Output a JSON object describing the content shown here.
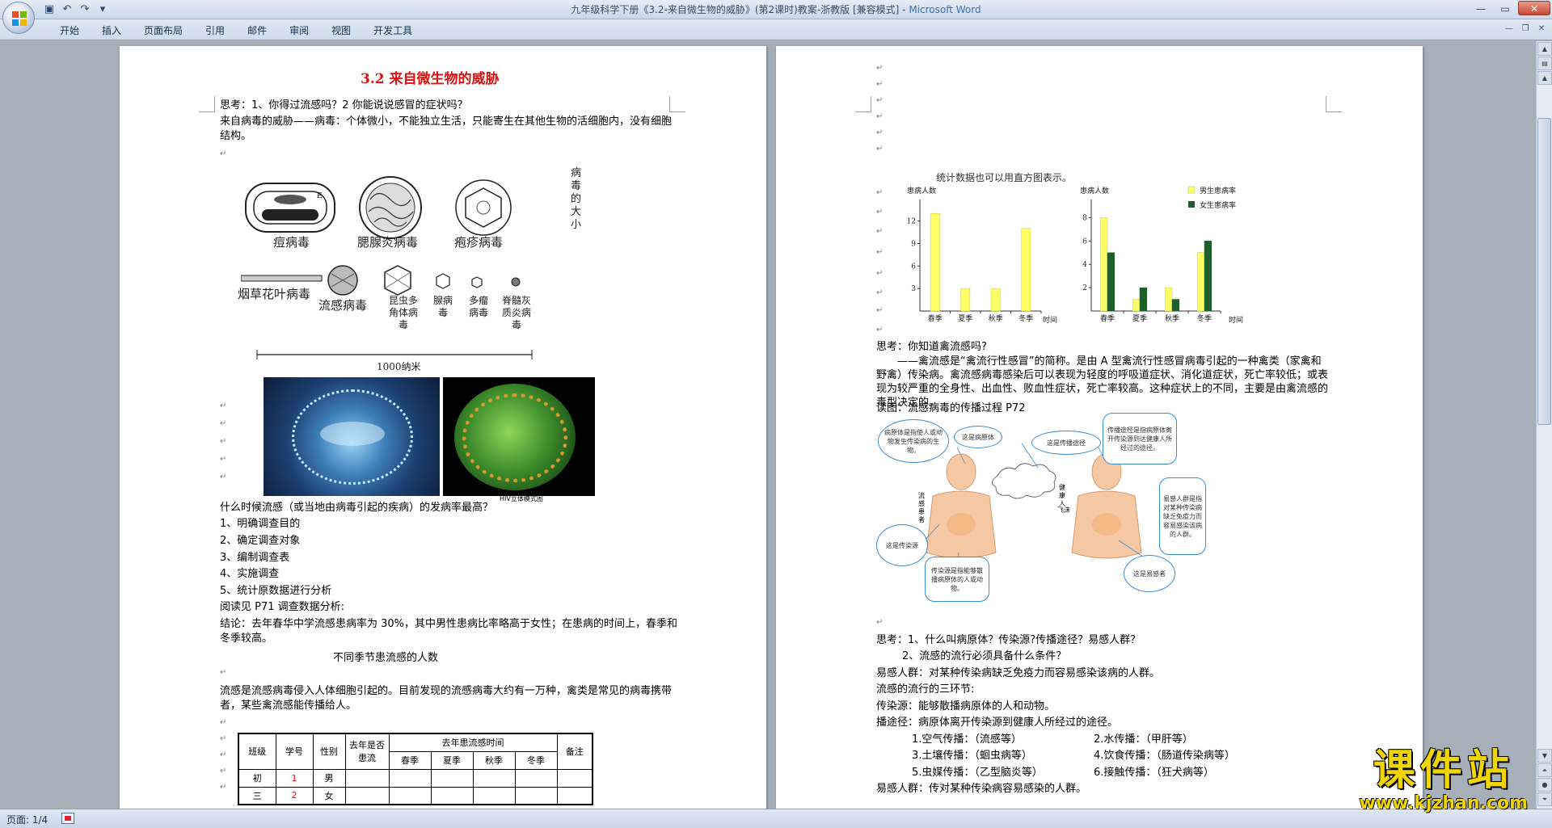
{
  "window": {
    "title_doc": "九年级科学下册《3.2-来自微生物的威胁》(第2课时)教案-浙教版 [兼容模式]",
    "title_sep": " - ",
    "title_app": "Microsoft Word"
  },
  "ribbon": {
    "tabs": [
      "开始",
      "插入",
      "页面布局",
      "引用",
      "邮件",
      "审阅",
      "视图",
      "开发工具"
    ]
  },
  "status": {
    "page": "页面: 1/4"
  },
  "watermark": {
    "brand": "课件站",
    "url": "www.kjzhan.com"
  },
  "page1": {
    "title": "3.2  来自微生物的威胁",
    "think1": "思考：1、你得过流感吗？2 你能说说感冒的症状吗？",
    "virus_intro": "来自病毒的威胁——病毒：个体微小，不能独立生活，只能寄生在其他生物的活细胞内，没有细胞结构。",
    "virus_names_row1": [
      "痘病毒",
      "腮腺炎病毒",
      "疱疹病毒"
    ],
    "virus_size_label": "病毒的大小",
    "virus_names_row2": [
      "烟草花叶病毒",
      "流感病毒",
      "昆虫多角体病毒",
      "腺病毒",
      "多瘤病毒",
      "脊髓灰质炎病毒"
    ],
    "scale_label": "1000纳米",
    "photo_caption": "HIV立体模式图",
    "question": "什么时候流感（或当地由病毒引起的疾病）的发病率最高？",
    "steps": [
      "1、明确调查目的",
      "2、确定调查对象",
      "3、编制调查表",
      "4、实施调查",
      "5、统计原数据进行分析"
    ],
    "read": "阅读见 P71 调查数据分析:",
    "conclusion": "结论：去年春华中学流感患病率为 30%，其中男性患病比率略高于女性；在患病的时间上，春季和冬季较高。",
    "table_title": "不同季节患流感的人数",
    "flu_text": "流感是流感病毒侵入人体细胞引起的。目前发现的流感病毒大约有一万种，禽类是常见的病毒携带者，某些禽流感能传播给人。",
    "table": {
      "headers": [
        "班级",
        "学号",
        "性别",
        "去年是否患流",
        "去年患流感时间",
        "备注"
      ],
      "seasons": [
        "春季",
        "夏季",
        "秋季",
        "冬季"
      ],
      "rows": [
        {
          "class": "初",
          "id": "1",
          "sex": "男"
        },
        {
          "class": "三",
          "id": "2",
          "sex": "女"
        }
      ]
    }
  },
  "page2": {
    "chart_caption": "统计数据也可以用直方图表示。",
    "think2": "思考：你知道禽流感吗?",
    "bird_flu_text": "——禽流感是“禽流行性感冒”的简称。是由 A 型禽流行性感冒病毒引起的一种禽类（家禽和野禽）传染病。禽流感病毒感染后可以表现为轻度的呼吸道症状、消化道症状，死亡率较低；或表现为较严重的全身性、出血性、败血性症状，死亡率较高。这种症状上的不同，主要是由禽流感的毒型决定的。",
    "read_fig": "读图：流感病毒的传播过程 P72",
    "diagram": {
      "pathogen": "病原体是指使人或动物发生传染病的生物。",
      "host_a": "这是病原体",
      "host_b": "这是传播途径",
      "route": "传播途径是指病原体离开传染源到达健康人所经过的途径。",
      "susceptible": "易感人群是指对某种传染病缺乏免疫力而容易感染该病的人群。",
      "source": "传染源是指能够散播病原体的人或动物。",
      "source_b": "这是传染源",
      "sus_b": "这是易感者",
      "label_patient": "流感患者",
      "label_healthy": "健康人",
      "label_fly": "飞沫"
    },
    "think3": "思考：1、什么叫病原体？传染源?传播途径？易感人群？",
    "think3b": "2、流感的流行必须具备什么条件？",
    "def_susceptible": "易感人群：对某种传染病缺乏免疫力而容易感染该病的人群。",
    "three_links": "流感的流行的三环节:",
    "def_source": "传染源：能够散播病原体的人和动物。",
    "def_route": "播途径：病原体离开传染源到健康人所经过的途径。",
    "routes": [
      [
        "1.空气传播：（流感等）",
        "2.水传播：（甲肝等）"
      ],
      [
        "3.土壤传播：（蛔虫病等）",
        "4.饮食传播：（肠道传染病等）"
      ],
      [
        "5.虫媒传播：（乙型脑炎等）",
        "6.接触传播：（狂犬病等）"
      ]
    ],
    "def_susceptible2": "易感人群：传对某种传染病容易感染的人群。"
  },
  "chart_data": [
    {
      "type": "bar",
      "title": "",
      "ylabel": "患病人数",
      "xlabel": "时间",
      "categories": [
        "春季",
        "夏季",
        "秋季",
        "冬季"
      ],
      "values": [
        13,
        3,
        3,
        11
      ],
      "ylim": [
        0,
        14
      ],
      "yticks": [
        3,
        6,
        9,
        12
      ],
      "colors": [
        "#ffff66"
      ]
    },
    {
      "type": "bar",
      "title": "",
      "ylabel": "患病人数",
      "xlabel": "时间",
      "categories": [
        "春季",
        "夏季",
        "秋季",
        "冬季"
      ],
      "series": [
        {
          "name": "男生患病率",
          "values": [
            8,
            1,
            2,
            5
          ],
          "color": "#ffff66"
        },
        {
          "name": "女生患病率",
          "values": [
            5,
            2,
            1,
            6
          ],
          "color": "#1f5e2a"
        }
      ],
      "ylim": [
        0,
        9
      ],
      "yticks": [
        2,
        4,
        6,
        8
      ],
      "legend": "top-right"
    }
  ]
}
